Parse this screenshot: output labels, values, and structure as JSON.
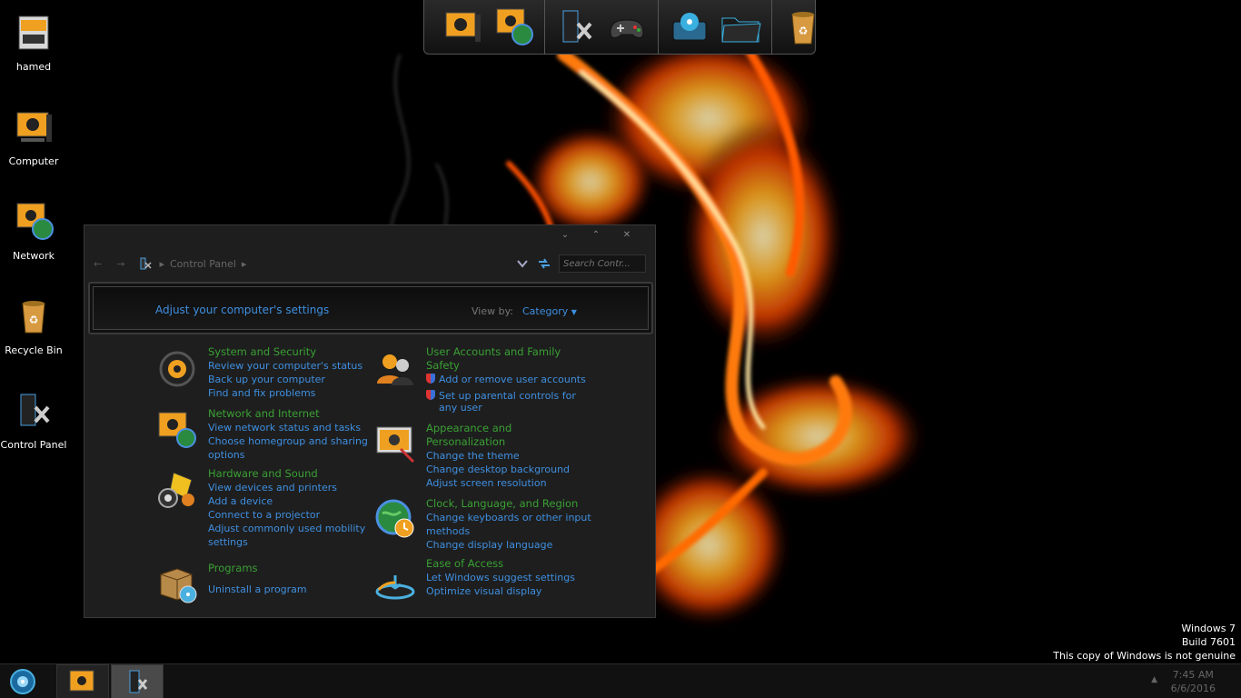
{
  "desktop": {
    "icons": [
      {
        "label": "hamed",
        "icon": "user-folder-icon"
      },
      {
        "label": "Computer",
        "icon": "computer-icon"
      },
      {
        "label": "Network",
        "icon": "network-icon"
      },
      {
        "label": "Recycle Bin",
        "icon": "recycle-bin-icon"
      },
      {
        "label": "Control Panel",
        "icon": "control-panel-icon"
      }
    ]
  },
  "dock": {
    "items": [
      "computer-icon",
      "network-icon",
      "control-panel-icon",
      "gamepad-icon",
      "hard-drive-icon",
      "folder-icon",
      "recycle-bin-icon"
    ]
  },
  "window": {
    "controls": {
      "minimize": "⌄",
      "maximize": "⌃",
      "close": "✕"
    },
    "nav": {
      "back": "←",
      "forward": "→"
    },
    "breadcrumb": [
      "Control Panel"
    ],
    "search_placeholder": "Search Contr...",
    "banner_title": "Adjust your computer's settings",
    "view_by_label": "View by:",
    "view_by_value": "Category",
    "categories": [
      {
        "title": "System and Security",
        "links": [
          "Review your computer's status",
          "Back up your computer",
          "Find and fix problems"
        ]
      },
      {
        "title": "Network and Internet",
        "links": [
          "View network status and tasks",
          "Choose homegroup and sharing",
          "options"
        ]
      },
      {
        "title": "Hardware and Sound",
        "links": [
          "View devices and printers",
          "Add a device",
          "Connect to a projector",
          "Adjust commonly used mobility",
          "settings"
        ]
      },
      {
        "title": "Programs",
        "links": [
          "Uninstall a program"
        ]
      },
      {
        "title": "User Accounts and Family",
        "title2": "Safety",
        "links": [
          "Add or remove user accounts",
          "Set up parental controls for",
          "any user"
        ]
      },
      {
        "title": "Appearance and",
        "title2": "Personalization",
        "links": [
          "Change the theme",
          "Change desktop background",
          "Adjust screen resolution"
        ]
      },
      {
        "title": "Clock, Language, and Region",
        "links": [
          "Change keyboards or other input",
          "methods",
          "Change display language"
        ]
      },
      {
        "title": "Ease of Access",
        "links": [
          "Let Windows suggest settings",
          "Optimize visual display"
        ]
      }
    ]
  },
  "watermark": {
    "line1": "Windows 7",
    "line2": "Build 7601",
    "line3": "This copy of Windows is not genuine"
  },
  "taskbar": {
    "time": "7:45 AM",
    "date": "6/6/2016",
    "tray_arrow": "▲"
  }
}
